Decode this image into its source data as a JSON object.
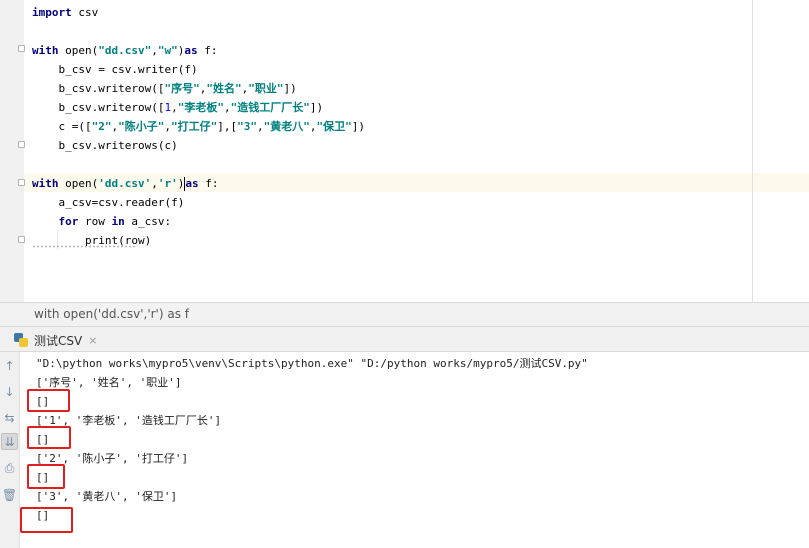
{
  "editor": {
    "lines": [
      [
        {
          "t": "import",
          "c": "kw"
        },
        {
          "t": " csv"
        }
      ],
      [],
      [
        {
          "t": "with",
          "c": "kw"
        },
        {
          "t": " open("
        },
        {
          "t": "\"dd.csv\"",
          "c": "str"
        },
        {
          "t": ","
        },
        {
          "t": "\"w\"",
          "c": "str"
        },
        {
          "t": ")"
        },
        {
          "t": "as",
          "c": "kw"
        },
        {
          "t": " f:"
        }
      ],
      [
        {
          "t": "    b_csv = csv.writer(f)"
        }
      ],
      [
        {
          "t": "    b_csv.writerow(["
        },
        {
          "t": "\"序号\"",
          "c": "str"
        },
        {
          "t": ","
        },
        {
          "t": "\"姓名\"",
          "c": "str"
        },
        {
          "t": ","
        },
        {
          "t": "\"职业\"",
          "c": "str"
        },
        {
          "t": "])"
        }
      ],
      [
        {
          "t": "    b_csv.writerow(["
        },
        {
          "t": "1",
          "c": "num"
        },
        {
          "t": ","
        },
        {
          "t": "\"李老板\"",
          "c": "str"
        },
        {
          "t": ","
        },
        {
          "t": "\"造钱工厂厂长\"",
          "c": "str"
        },
        {
          "t": "])"
        }
      ],
      [
        {
          "t": "    c =(["
        },
        {
          "t": "\"2\"",
          "c": "str"
        },
        {
          "t": ","
        },
        {
          "t": "\"陈小子\"",
          "c": "str"
        },
        {
          "t": ","
        },
        {
          "t": "\"打工仔\"",
          "c": "str"
        },
        {
          "t": "],["
        },
        {
          "t": "\"3\"",
          "c": "str"
        },
        {
          "t": ","
        },
        {
          "t": "\"黄老八\"",
          "c": "str"
        },
        {
          "t": ","
        },
        {
          "t": "\"保卫\"",
          "c": "str"
        },
        {
          "t": "])"
        }
      ],
      [
        {
          "t": "    b_csv.writerows(c)"
        }
      ],
      [],
      [
        {
          "t": "with",
          "c": "kw"
        },
        {
          "t": " open("
        },
        {
          "t": "'dd.csv'",
          "c": "str"
        },
        {
          "t": ","
        },
        {
          "t": "'r'",
          "c": "str"
        },
        {
          "t": ")"
        },
        {
          "t": "",
          "c": "caret"
        },
        {
          "t": "as",
          "c": "kw"
        },
        {
          "t": " f:"
        }
      ],
      [
        {
          "t": "    a_csv=csv.reader(f)"
        }
      ],
      [
        {
          "t": "    "
        },
        {
          "t": "for",
          "c": "kw"
        },
        {
          "t": " row "
        },
        {
          "t": "in",
          "c": "kw"
        },
        {
          "t": " a_csv:"
        }
      ],
      [
        {
          "t": "        print(row)"
        }
      ]
    ]
  },
  "breadcrumb": {
    "text": "with open('dd.csv','r') as f"
  },
  "run": {
    "tab_label": "测试CSV",
    "close_glyph": "×",
    "output": [
      "\"D:\\python works\\mypro5\\venv\\Scripts\\python.exe\" \"D:/python works/mypro5/测试CSV.py\"",
      "['序号', '姓名', '职业']",
      "[]",
      "['1', '李老板', '造钱工厂厂长']",
      "[]",
      "['2', '陈小子', '打工仔']",
      "[]",
      "['3', '黄老八', '保卫']",
      "[]"
    ]
  },
  "toolbar": {
    "icons": [
      {
        "name": "rerun-up-icon",
        "glyph": "↑"
      },
      {
        "name": "scroll-down-icon",
        "glyph": "↓"
      },
      {
        "name": "soft-wrap-icon",
        "glyph": "⇆"
      },
      {
        "name": "scroll-to-end-icon",
        "glyph": "⇊"
      },
      {
        "name": "print-icon",
        "glyph": "⎙"
      },
      {
        "name": "trash-icon",
        "glyph": "🗑"
      }
    ]
  },
  "colors": {
    "annotation": "#e02020",
    "keyword": "#000080",
    "string": "#008080"
  }
}
